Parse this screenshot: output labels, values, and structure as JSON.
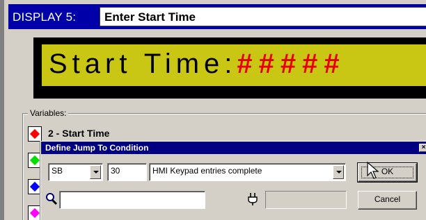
{
  "display": {
    "label": "DISPLAY 5:",
    "name": "Enter Start Time"
  },
  "lcd": {
    "text": "Start Time:",
    "hashes": "#####",
    "background_color": "#c9c714",
    "hash_color": "#e80000"
  },
  "variables": {
    "group_label": "Variables:",
    "rows": [
      {
        "label": "2 - Start Time",
        "color": "#ff0000"
      },
      {
        "label": "",
        "color": "#00e000"
      },
      {
        "label": "",
        "color": "#0000ff"
      },
      {
        "label": "",
        "color": "#ff00ff"
      }
    ]
  },
  "dialog": {
    "title": "Define Jump To Condition",
    "close_glyph": "×",
    "type_select": "SB",
    "number_value": "30",
    "condition_select": "HMI Keypad entries complete",
    "search_value": "",
    "ok_label": "OK",
    "cancel_label": "Cancel"
  },
  "icons": {
    "search": "search-icon",
    "plug": "plug-icon",
    "cursor": "mouse-cursor"
  }
}
